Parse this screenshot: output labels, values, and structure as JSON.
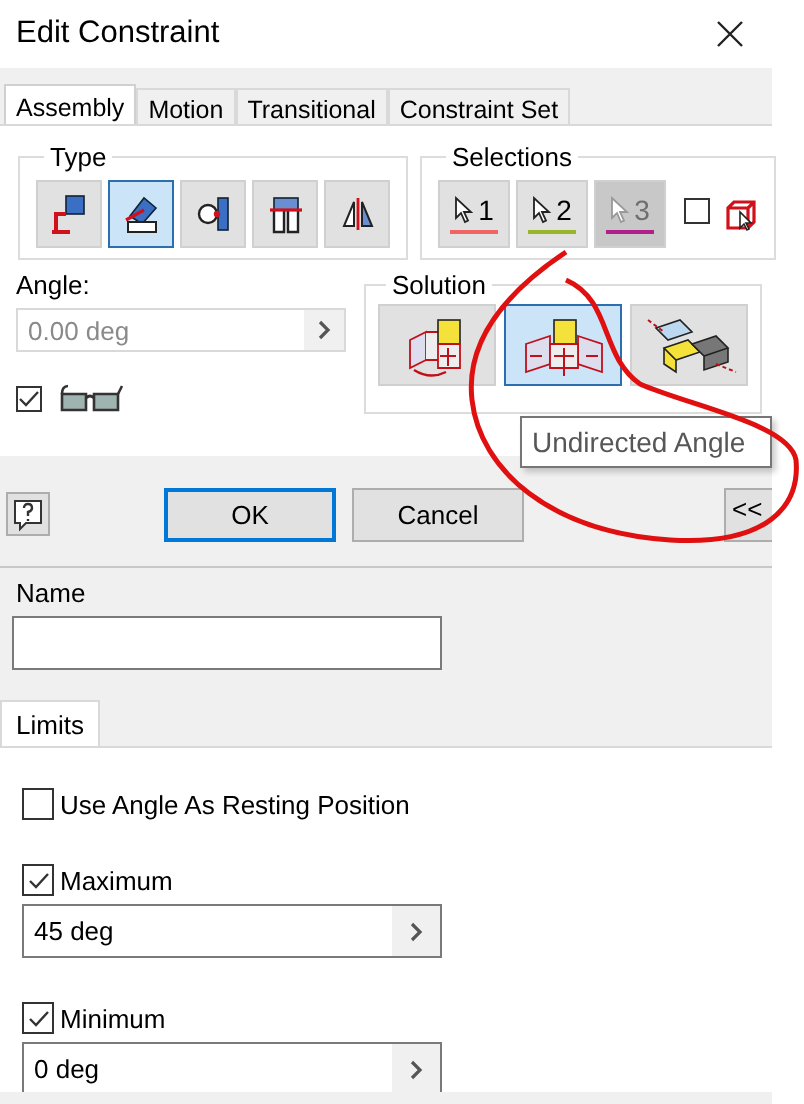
{
  "window": {
    "title": "Edit Constraint"
  },
  "tabs": [
    {
      "label": "Assembly",
      "selected": true
    },
    {
      "label": "Motion",
      "selected": false
    },
    {
      "label": "Transitional",
      "selected": false
    },
    {
      "label": "Constraint Set",
      "selected": false
    }
  ],
  "type_group": {
    "title": "Type",
    "buttons": [
      {
        "kind": "mate",
        "selected": false
      },
      {
        "kind": "angle",
        "selected": true
      },
      {
        "kind": "tangent",
        "selected": false
      },
      {
        "kind": "insert",
        "selected": false
      },
      {
        "kind": "symmetry",
        "selected": false
      }
    ]
  },
  "selections": {
    "title": "Selections",
    "buttons": [
      {
        "label": "1",
        "color": "#f06464",
        "disabled": false
      },
      {
        "label": "2",
        "color": "#9ab52c",
        "disabled": false
      },
      {
        "label": "3",
        "color": "#b0208a",
        "disabled": true
      }
    ],
    "pick_part_first": {
      "checked": false
    }
  },
  "angle": {
    "label": "Angle:",
    "value": "0.00 deg",
    "disabled": true
  },
  "preview": {
    "checked": true
  },
  "solution": {
    "title": "Solution",
    "buttons": [
      {
        "kind": "directed",
        "selected": false
      },
      {
        "kind": "undirected",
        "selected": true
      },
      {
        "kind": "explicit",
        "selected": false
      }
    ]
  },
  "tooltip": {
    "text": "Undirected Angle"
  },
  "buttons": [
    {
      "label": "OK",
      "selected": true
    },
    {
      "label": "Cancel",
      "selected": false
    }
  ],
  "more_button": {
    "label": "<<"
  },
  "name": {
    "label": "Name"
  },
  "lower_tabs": [
    {
      "label": "Limits",
      "selected": true
    }
  ],
  "limits": [
    {
      "kind": "checkbox",
      "label": "Use Angle As Resting Position",
      "checked": false
    },
    {
      "kind": "limit",
      "label": "Maximum",
      "checked": true,
      "value": "45 deg"
    },
    {
      "kind": "limit",
      "label": "Minimum",
      "checked": true,
      "value": "0 deg"
    }
  ]
}
